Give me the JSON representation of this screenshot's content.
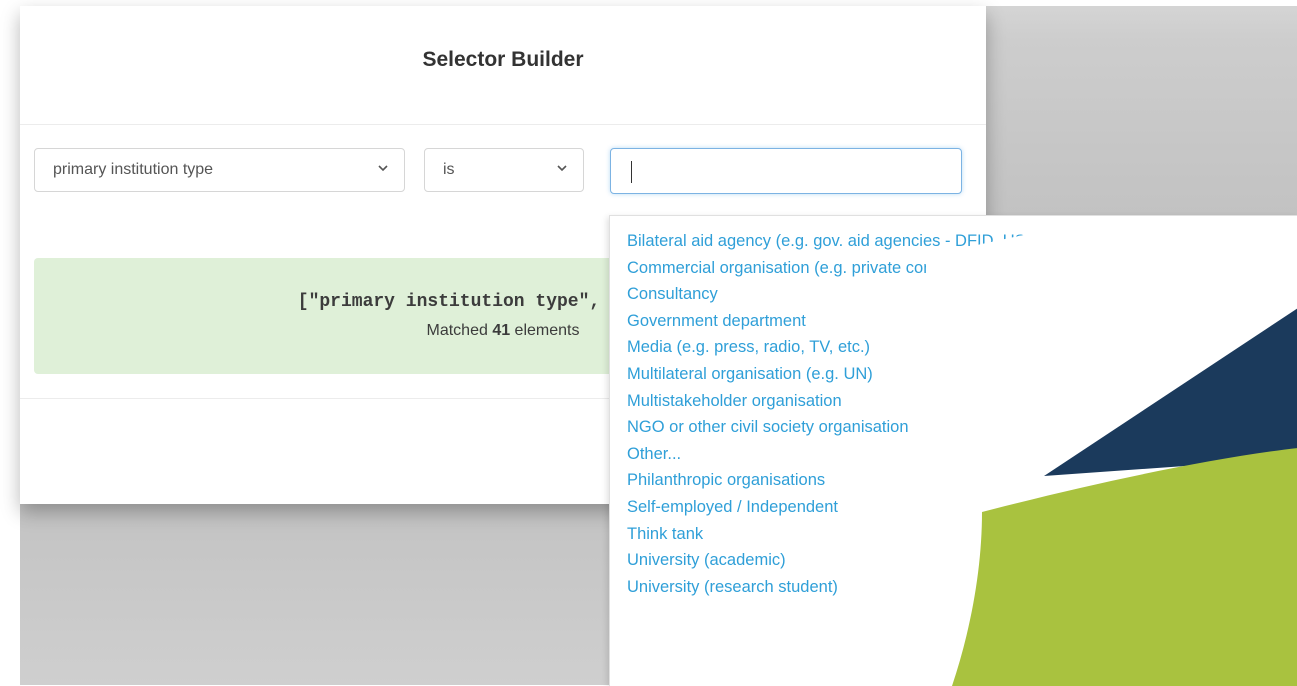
{
  "modal": {
    "title": "Selector Builder"
  },
  "filter": {
    "field_value": "primary institution type",
    "operator_value": "is",
    "value_input": ""
  },
  "result": {
    "query_text": "[\"primary institution type\", \"is\", \"\"]",
    "matched_prefix": "Matched ",
    "matched_count": "41",
    "matched_suffix": " elements"
  },
  "dropdown": {
    "options": [
      "Bilateral aid agency (e.g. gov. aid agencies - DFID, USAID etc.)",
      "Commercial organisation (e.g. private companies)",
      "Consultancy",
      "Government department",
      "Media (e.g. press, radio, TV, etc.)",
      "Multilateral organisation (e.g. UN)",
      "Multistakeholder organisation",
      "NGO or other civil society organisation",
      "Other...",
      "Philanthropic organisations",
      "Self-employed / Independent",
      "Think tank",
      "University (academic)",
      "University (research student)"
    ]
  },
  "colors": {
    "option_text": "#2f9fd8",
    "result_bg": "#dff0d8",
    "logo_navy": "#1b3a5c",
    "logo_green": "#a9c23f"
  },
  "icons": {
    "field_select": "chevron-down-icon",
    "operator_select": "chevron-down-icon"
  }
}
